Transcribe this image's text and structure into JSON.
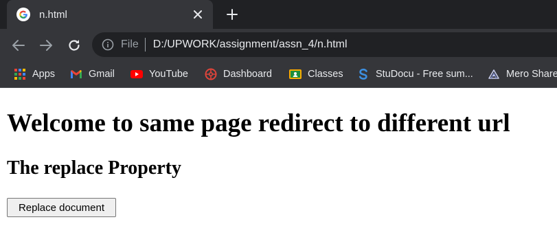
{
  "tab": {
    "title": "n.html",
    "favicon": "google-g-icon",
    "close_icon": "close-icon",
    "new_tab_icon": "plus-icon"
  },
  "toolbar": {
    "back_icon": "back-arrow-icon",
    "forward_icon": "forward-arrow-icon",
    "reload_icon": "reload-icon",
    "info_icon": "info-icon",
    "scheme": "File",
    "url": "D:/UPWORK/assignment/assn_4/n.html"
  },
  "bookmarks": [
    {
      "label": "Apps",
      "icon": "apps-grid-icon"
    },
    {
      "label": "Gmail",
      "icon": "gmail-icon"
    },
    {
      "label": "YouTube",
      "icon": "youtube-icon"
    },
    {
      "label": "Dashboard",
      "icon": "dashboard-icon"
    },
    {
      "label": "Classes",
      "icon": "classes-icon"
    },
    {
      "label": "StuDocu - Free sum...",
      "icon": "studocu-icon"
    },
    {
      "label": "Mero Share",
      "icon": "mero-share-icon"
    }
  ],
  "page": {
    "heading": "Welcome to same page redirect to different url",
    "subheading": "The replace Property",
    "button_label": "Replace document"
  },
  "colors": {
    "chrome_dark": "#202124",
    "chrome_tab": "#35363a",
    "chrome_text": "#e8eaed",
    "chrome_muted": "#9aa0a6",
    "page_bg": "#ffffff"
  }
}
